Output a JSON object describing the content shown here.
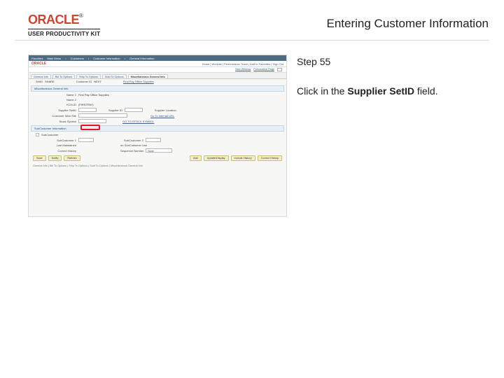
{
  "header": {
    "brand": "ORACLE",
    "tm": "®",
    "product": "USER PRODUCTIVITY KIT",
    "page_title": "Entering Customer Information"
  },
  "instructions": {
    "step_label": "Step 55",
    "line_prefix": "Click in the ",
    "field_name": "Supplier SetID",
    "line_suffix": " field."
  },
  "screenshot": {
    "topbar": {
      "fav": "Favorites",
      "main": "Main Menu",
      "crumb1": "Customers",
      "crumb2": "Customer Information",
      "crumb3": "General Information"
    },
    "nav_left": "ORACLE",
    "nav_right": {
      "home": "Home",
      "worklist": "Worklist",
      "perf": "Performance Trace",
      "addfav": "Add to Favorites",
      "signout": "Sign Out"
    },
    "userline": {
      "newwin": "New Window",
      "pers": "Personalize Page"
    },
    "tabs": {
      "t1": "General Info",
      "t2": "Bill To Options",
      "t3": "Ship To Options",
      "t4": "Sold To Options",
      "t5": "Miscellaneous General Info"
    },
    "line1": {
      "setid_lbl": "SetID",
      "setid_val": "SHARE",
      "cust_lbl": "Customer ID",
      "cust_val": "NEXT"
    },
    "sectionA": "Miscellaneous General Info",
    "name1_lbl": "Name 1",
    "name1_val": "First Pay Office Supplies",
    "name2_lbl": "Name 2",
    "kch_lbl": "KCH-ID",
    "kch_val": "(FIRSTPAY)",
    "suppsetid_lbl": "Supplier SetID",
    "suppid_lbl": "Supplier ID",
    "supploc_lbl": "Supplier Location",
    "web_lbl": "Customer Web Site",
    "cust_url_lbl": "Go To Internal URL",
    "stock_lbl": "Stock Symbol",
    "stock_link": "GO TO STOCK SYMBOL",
    "sectionB": "SubCustomer Information",
    "subcust_chk": "SubCustomer",
    "sub1_lbl": "SubCustomer 1",
    "sub2_lbl": "SubCustomer 2",
    "lastmaint_lbl": "Last Maintained",
    "onsub_lbl": "on SubCustomer Use ",
    "seqnum_lbl": "Sequence Number",
    "seqnum_val": "None",
    "correct_lbl": "Correct History",
    "buttons": {
      "save": "Save",
      "notify": "Notify",
      "refresh": "Refresh",
      "add": "Add",
      "update": "Update/Display",
      "incl": "Include History",
      "corr": "Correct History"
    },
    "footer_tabs": "General Info | Bill To Options | Ship To Options | Sold To Options | Miscellaneous General Info"
  }
}
